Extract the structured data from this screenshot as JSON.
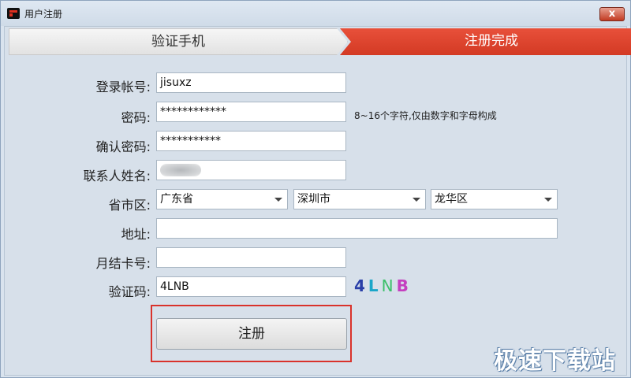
{
  "window": {
    "title": "用户注册",
    "close_label": "x"
  },
  "steps": {
    "step1": "验证手机",
    "step2": "注册完成"
  },
  "form": {
    "account_label": "登录帐号:",
    "account_value": "jisuxz",
    "password_label": "密码:",
    "password_value": "************",
    "password_hint": "8~16个字符,仅由数字和字母构成",
    "confirm_label": "确认密码:",
    "confirm_value": "***********",
    "contact_label": "联系人姓名:",
    "region_label": "省市区:",
    "province": "广东省",
    "city": "深圳市",
    "district": "龙华区",
    "address_label": "地址:",
    "address_value": "",
    "card_label": "月结卡号:",
    "card_value": "",
    "captcha_label": "验证码:",
    "captcha_value": "4LNB",
    "captcha_chars": [
      "4",
      "L",
      "N",
      "B"
    ],
    "captcha_colors": [
      "#2a3fa8",
      "#1aa6c9",
      "#3cc06a",
      "#c43fbf"
    ]
  },
  "submit_label": "注册",
  "watermark": "极速下载站"
}
